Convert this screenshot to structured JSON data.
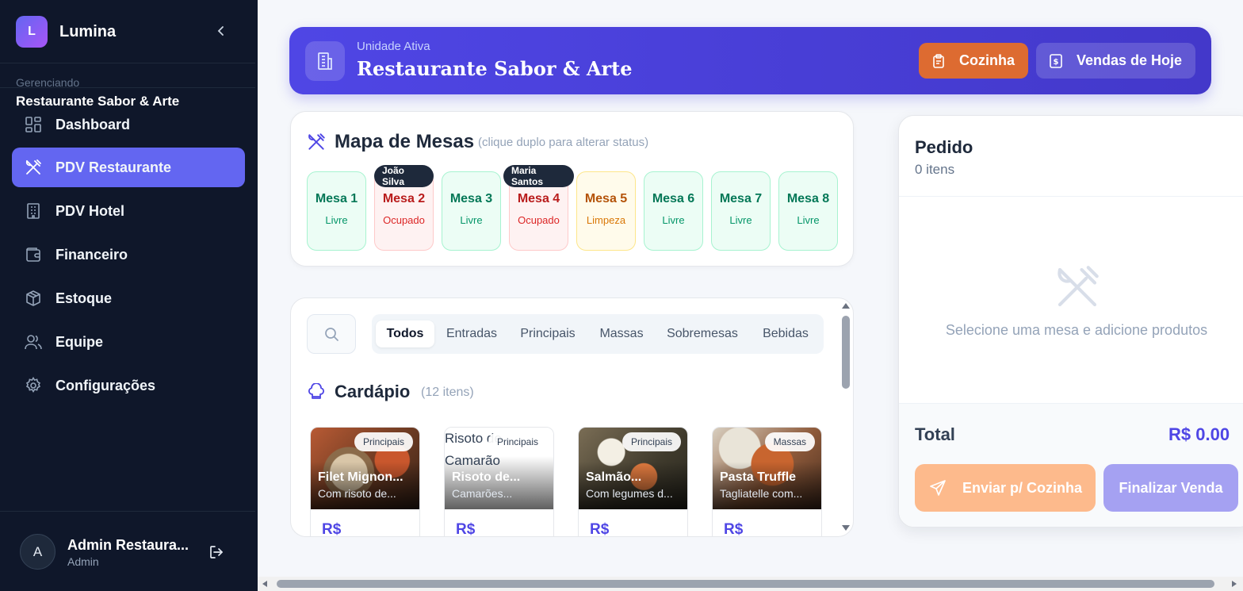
{
  "app": {
    "logo_letter": "L",
    "name": "Lumina"
  },
  "sidebar": {
    "managing_label": "Gerenciando",
    "managing_name": "Restaurante Sabor & Arte",
    "items": [
      {
        "label": "Dashboard",
        "icon": "grid-icon"
      },
      {
        "label": "PDV Restaurante",
        "icon": "utensils-icon",
        "active": true
      },
      {
        "label": "PDV Hotel",
        "icon": "building-icon"
      },
      {
        "label": "Financeiro",
        "icon": "wallet-icon"
      },
      {
        "label": "Estoque",
        "icon": "box-icon"
      },
      {
        "label": "Equipe",
        "icon": "users-icon"
      },
      {
        "label": "Configurações",
        "icon": "gear-icon"
      }
    ],
    "user": {
      "initial": "A",
      "name": "Admin Restaura...",
      "role": "Admin"
    }
  },
  "banner": {
    "subtitle": "Unidade Ativa",
    "title": "Restaurante Sabor & Arte",
    "kitchen_label": "Cozinha",
    "sales_label": "Vendas de Hoje"
  },
  "table_map": {
    "title": "Mapa de Mesas",
    "hint": "(clique duplo para alterar status)",
    "tables": [
      {
        "name": "Mesa 1",
        "status": "Livre"
      },
      {
        "name": "Mesa 2",
        "status": "Ocupado",
        "guest": "João Silva"
      },
      {
        "name": "Mesa 3",
        "status": "Livre"
      },
      {
        "name": "Mesa 4",
        "status": "Ocupado",
        "guest": "Maria Santos"
      },
      {
        "name": "Mesa 5",
        "status": "Limpeza"
      },
      {
        "name": "Mesa 6",
        "status": "Livre"
      },
      {
        "name": "Mesa 7",
        "status": "Livre"
      },
      {
        "name": "Mesa 8",
        "status": "Livre"
      }
    ]
  },
  "menu": {
    "tabs": [
      "Todos",
      "Entradas",
      "Principais",
      "Massas",
      "Sobremesas",
      "Bebidas"
    ],
    "active_tab": "Todos",
    "title": "Cardápio",
    "count": "(12 itens)",
    "products": [
      {
        "tag": "Principais",
        "name": "Filet Mignon...",
        "desc": "Com risoto de...",
        "price": "R$"
      },
      {
        "tag": "Principais",
        "name": "Risoto de...",
        "desc": "Camarões...",
        "price": "R$",
        "alt": "Risoto de Camarão"
      },
      {
        "tag": "Principais",
        "name": "Salmão...",
        "desc": "Com legumes d...",
        "price": "R$"
      },
      {
        "tag": "Massas",
        "name": "Pasta Truffle",
        "desc": "Tagliatelle com...",
        "price": "R$"
      }
    ]
  },
  "order": {
    "title": "Pedido",
    "count": "0 itens",
    "empty_text": "Selecione uma mesa e adicione produtos",
    "total_label": "Total",
    "total_value": "R$ 0.00",
    "send_label": "Enviar p/ Cozinha",
    "finish_label": "Finalizar Venda"
  },
  "colors": {
    "accent": "#6366f1",
    "sidebar": "#0f172a",
    "kitchen": "#dd6b31"
  }
}
